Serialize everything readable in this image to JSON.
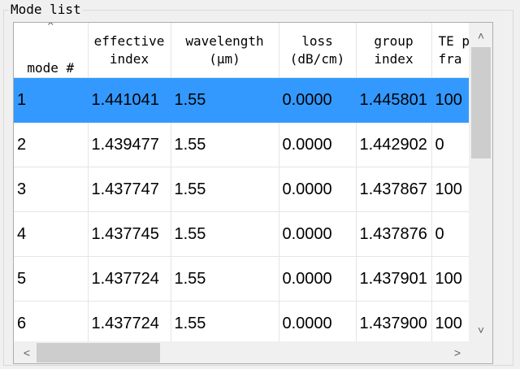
{
  "group": {
    "title": "Mode list"
  },
  "sort_indicator": "^",
  "table": {
    "columns": [
      {
        "label": "mode #"
      },
      {
        "label": "effective\nindex"
      },
      {
        "label": "wavelength\n(μm)"
      },
      {
        "label": "loss\n(dB/cm)"
      },
      {
        "label": "group\nindex"
      },
      {
        "label": "TE p\nfra"
      }
    ],
    "rows": [
      {
        "cells": [
          "1",
          "1.441041",
          "1.55",
          "0.0000",
          "1.445801",
          "100"
        ],
        "selected": true
      },
      {
        "cells": [
          "2",
          "1.439477",
          "1.55",
          "0.0000",
          "1.442902",
          "0"
        ],
        "selected": false
      },
      {
        "cells": [
          "3",
          "1.437747",
          "1.55",
          "0.0000",
          "1.437867",
          "100"
        ],
        "selected": false
      },
      {
        "cells": [
          "4",
          "1.437745",
          "1.55",
          "0.0000",
          "1.437876",
          "0"
        ],
        "selected": false
      },
      {
        "cells": [
          "5",
          "1.437724",
          "1.55",
          "0.0000",
          "1.437901",
          "100"
        ],
        "selected": false
      },
      {
        "cells": [
          "6",
          "1.437724",
          "1.55",
          "0.0000",
          "1.437900",
          "100"
        ],
        "selected": false
      }
    ]
  },
  "scrollbars": {
    "vertical": {
      "up_icon": "˄",
      "down_icon": "˅"
    },
    "horizontal": {
      "left_icon": "<",
      "right_icon": ">"
    }
  },
  "colors": {
    "selection": "#3399ff",
    "scroll_thumb": "#cdcdcd"
  }
}
